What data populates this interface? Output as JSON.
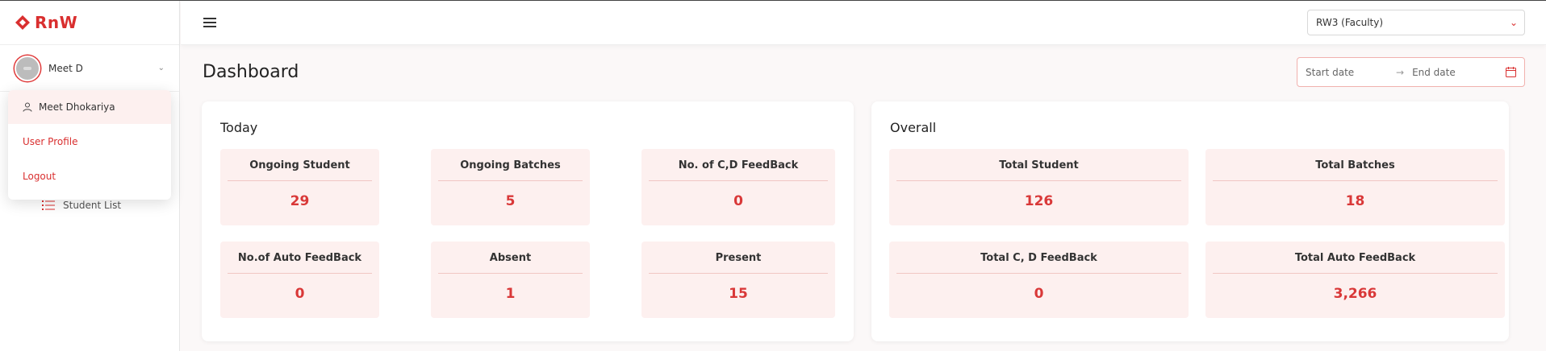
{
  "brand": {
    "name": "RnW",
    "color": "#d92f2f"
  },
  "sidebar": {
    "user": {
      "name": "Meet D"
    },
    "nav": [
      {
        "label": "Student List",
        "icon": "list-icon"
      }
    ]
  },
  "dropdown": {
    "full_name": "Meet Dhokariya",
    "items": [
      {
        "label": "User Profile"
      },
      {
        "label": "Logout"
      }
    ]
  },
  "topbar": {
    "role": "RW3 (Faculty)"
  },
  "page": {
    "title": "Dashboard",
    "date_range": {
      "start_placeholder": "Start date",
      "end_placeholder": "End date",
      "separator": "→"
    }
  },
  "today": {
    "title": "Today",
    "stats": [
      {
        "label": "Ongoing Student",
        "value": "29"
      },
      {
        "label": "Ongoing Batches",
        "value": "5"
      },
      {
        "label": "No. of C,D FeedBack",
        "value": "0"
      },
      {
        "label": "No.of Auto FeedBack",
        "value": "0"
      },
      {
        "label": "Absent",
        "value": "1"
      },
      {
        "label": "Present",
        "value": "15"
      }
    ]
  },
  "overall": {
    "title": "Overall",
    "stats": [
      {
        "label": "Total Student",
        "value": "126"
      },
      {
        "label": "Total Batches",
        "value": "18"
      },
      {
        "label": "Total C, D FeedBack",
        "value": "0"
      },
      {
        "label": "Total Auto FeedBack",
        "value": "3,266"
      }
    ]
  }
}
